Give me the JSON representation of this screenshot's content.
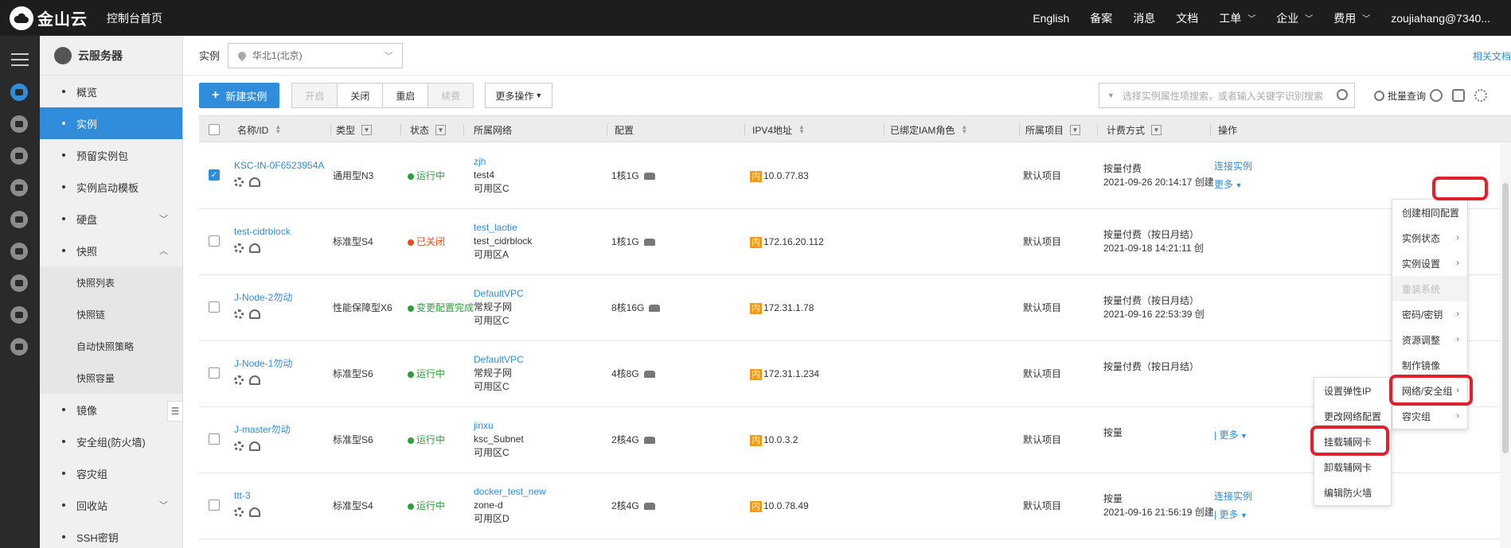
{
  "topbar": {
    "brand": "金山云",
    "home": "控制台首页",
    "nav": [
      {
        "label": "English",
        "dropdown": false
      },
      {
        "label": "备案",
        "dropdown": false
      },
      {
        "label": "消息",
        "dropdown": false
      },
      {
        "label": "文档",
        "dropdown": false
      },
      {
        "label": "工单",
        "dropdown": true
      },
      {
        "label": "企业",
        "dropdown": true
      },
      {
        "label": "费用",
        "dropdown": true
      },
      {
        "label": "zoujiahang@7340...",
        "dropdown": false
      }
    ]
  },
  "sidebar": {
    "title": "云服务器",
    "items": [
      {
        "label": "概览"
      },
      {
        "label": "实例",
        "active": true
      },
      {
        "label": "预留实例包"
      },
      {
        "label": "实例启动模板"
      },
      {
        "label": "硬盘",
        "expand": "down"
      },
      {
        "label": "快照",
        "expand": "up"
      }
    ],
    "sub_items": [
      "快照列表",
      "快照链",
      "自动快照策略",
      "快照容量"
    ],
    "items_after": [
      {
        "label": "镜像"
      },
      {
        "label": "安全组(防火墙)"
      },
      {
        "label": "容灾组"
      },
      {
        "label": "回收站",
        "expand": "down"
      },
      {
        "label": "SSH密钥"
      }
    ]
  },
  "region": {
    "label": "实例",
    "value": "华北1(北京)",
    "related_docs": "相关文档"
  },
  "toolbar": {
    "create": "新建实例",
    "start": "开启",
    "stop": "关闭",
    "restart": "重启",
    "renew": "续费",
    "more_ops": "更多操作",
    "search_placeholder": "选择实例属性项搜索，或者输入关键字识别搜索",
    "batch_query": "批量查询"
  },
  "table": {
    "headers": {
      "name": "名称/ID",
      "type": "类型",
      "status": "状态",
      "network": "所属网络",
      "config": "配置",
      "ipv4": "IPV4地址",
      "iam": "已绑定IAM角色",
      "project": "所属项目",
      "billing": "计费方式",
      "ops": "操作"
    },
    "ip_tag": "内",
    "rows": [
      {
        "name": "KSC-IN-0F6523954A",
        "checked": true,
        "type": "通用型N3",
        "status": "运行中",
        "status_kind": "run",
        "vpc": "zjh",
        "subnet": "test4",
        "zone": "可用区C",
        "config": "1核1G",
        "ip": "10.0.77.83",
        "project": "默认项目",
        "billing": "按量付费",
        "created": "2021-09-26 20:14:17 创建",
        "op1": "连接实例",
        "op2": "更多"
      },
      {
        "name": "test-cidrblock",
        "checked": false,
        "type": "标准型S4",
        "status": "已关闭",
        "status_kind": "off",
        "vpc": "test_laotie",
        "subnet": "test_cidrblock",
        "zone": "可用区A",
        "config": "1核1G",
        "ip": "172.16.20.112",
        "project": "默认项目",
        "billing": "按量付费（按日月结）",
        "created": "2021-09-18 14:21:11 创",
        "op1": "",
        "op2": ""
      },
      {
        "name": "J-Node-2勿动",
        "checked": false,
        "type": "性能保障型X6",
        "status": "变更配置完成",
        "status_kind": "run",
        "vpc": "DefaultVPC",
        "subnet": "常规子网",
        "zone": "可用区C",
        "config": "8核16G",
        "ip": "172.31.1.78",
        "project": "默认项目",
        "billing": "按量付费（按日月结）",
        "created": "2021-09-16 22:53:39 创",
        "op1": "",
        "op2": ""
      },
      {
        "name": "J-Node-1勿动",
        "checked": false,
        "type": "标准型S6",
        "status": "运行中",
        "status_kind": "run",
        "vpc": "DefaultVPC",
        "subnet": "常规子网",
        "zone": "可用区C",
        "config": "4核8G",
        "ip": "172.31.1.234",
        "project": "默认项目",
        "billing": "按量付费（按日月结）",
        "created": "",
        "op1": "",
        "op2": ""
      },
      {
        "name": "J-master勿动",
        "checked": false,
        "type": "标准型S6",
        "status": "运行中",
        "status_kind": "run",
        "vpc": "jinxu",
        "subnet": "ksc_Subnet",
        "zone": "可用区C",
        "config": "2核4G",
        "ip": "10.0.3.2",
        "project": "默认项目",
        "billing": "按量",
        "created": "",
        "op1": "",
        "op2": "| 更多"
      },
      {
        "name": "ttt-3",
        "checked": false,
        "type": "标准型S4",
        "status": "运行中",
        "status_kind": "run",
        "vpc": "docker_test_new",
        "subnet": "zone-d",
        "zone": "可用区D",
        "config": "2核4G",
        "ip": "10.0.78.49",
        "project": "默认项目",
        "billing": "按量",
        "created": "2021-09-16 21:56:19 创建",
        "op1": "连接实例",
        "op2": "| 更多"
      }
    ]
  },
  "more_menu": [
    {
      "label": "创建相同配置",
      "arrow": false
    },
    {
      "label": "实例状态",
      "arrow": true
    },
    {
      "label": "实例设置",
      "arrow": true
    },
    {
      "label": "重装系统",
      "arrow": false,
      "disabled": true
    },
    {
      "label": "密码/密钥",
      "arrow": true
    },
    {
      "label": "资源调整",
      "arrow": true
    },
    {
      "label": "制作镜像",
      "arrow": false
    },
    {
      "label": "网络/安全组",
      "arrow": true
    },
    {
      "label": "容灾组",
      "arrow": true
    }
  ],
  "network_submenu": [
    "设置弹性IP",
    "更改网络配置",
    "挂载辅网卡",
    "卸载辅网卡",
    "编辑防火墙"
  ],
  "partial_ops": {
    "connect": "连接实例"
  },
  "colors": {
    "accent": "#2f8ddb",
    "topbar": "#1d1d1d",
    "highlight": "#e0202c",
    "running": "#2aa13a",
    "stopped": "#e5501e",
    "ip_tag": "#f29a1a"
  }
}
